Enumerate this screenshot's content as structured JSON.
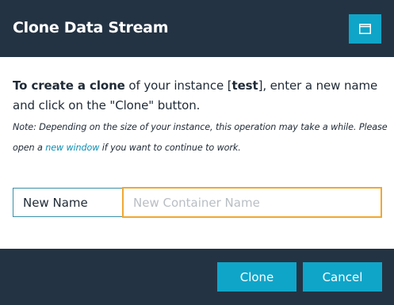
{
  "dialog": {
    "title": "Clone Data Stream",
    "maximize_icon": "window-maximize-icon"
  },
  "intro": {
    "bold_lead": "To create a clone",
    "text_1": " of your instance [",
    "instance_name": "test",
    "text_2": "], enter a new name and click on the \"Clone\" button."
  },
  "note": {
    "text_1": "Note: Depending on the size of your instance, this operation may take a while. Please open a ",
    "link_label": "new window",
    "text_2": " if you want to continue to work."
  },
  "form": {
    "name_label": "New Name",
    "name_value": "",
    "name_placeholder": "New Container Name"
  },
  "footer": {
    "clone_label": "Clone",
    "cancel_label": "Cancel"
  },
  "colors": {
    "header_bg": "#243343",
    "accent": "#0fa5c9",
    "input_focus_border": "#f0a830",
    "link": "#0d8fb3"
  }
}
